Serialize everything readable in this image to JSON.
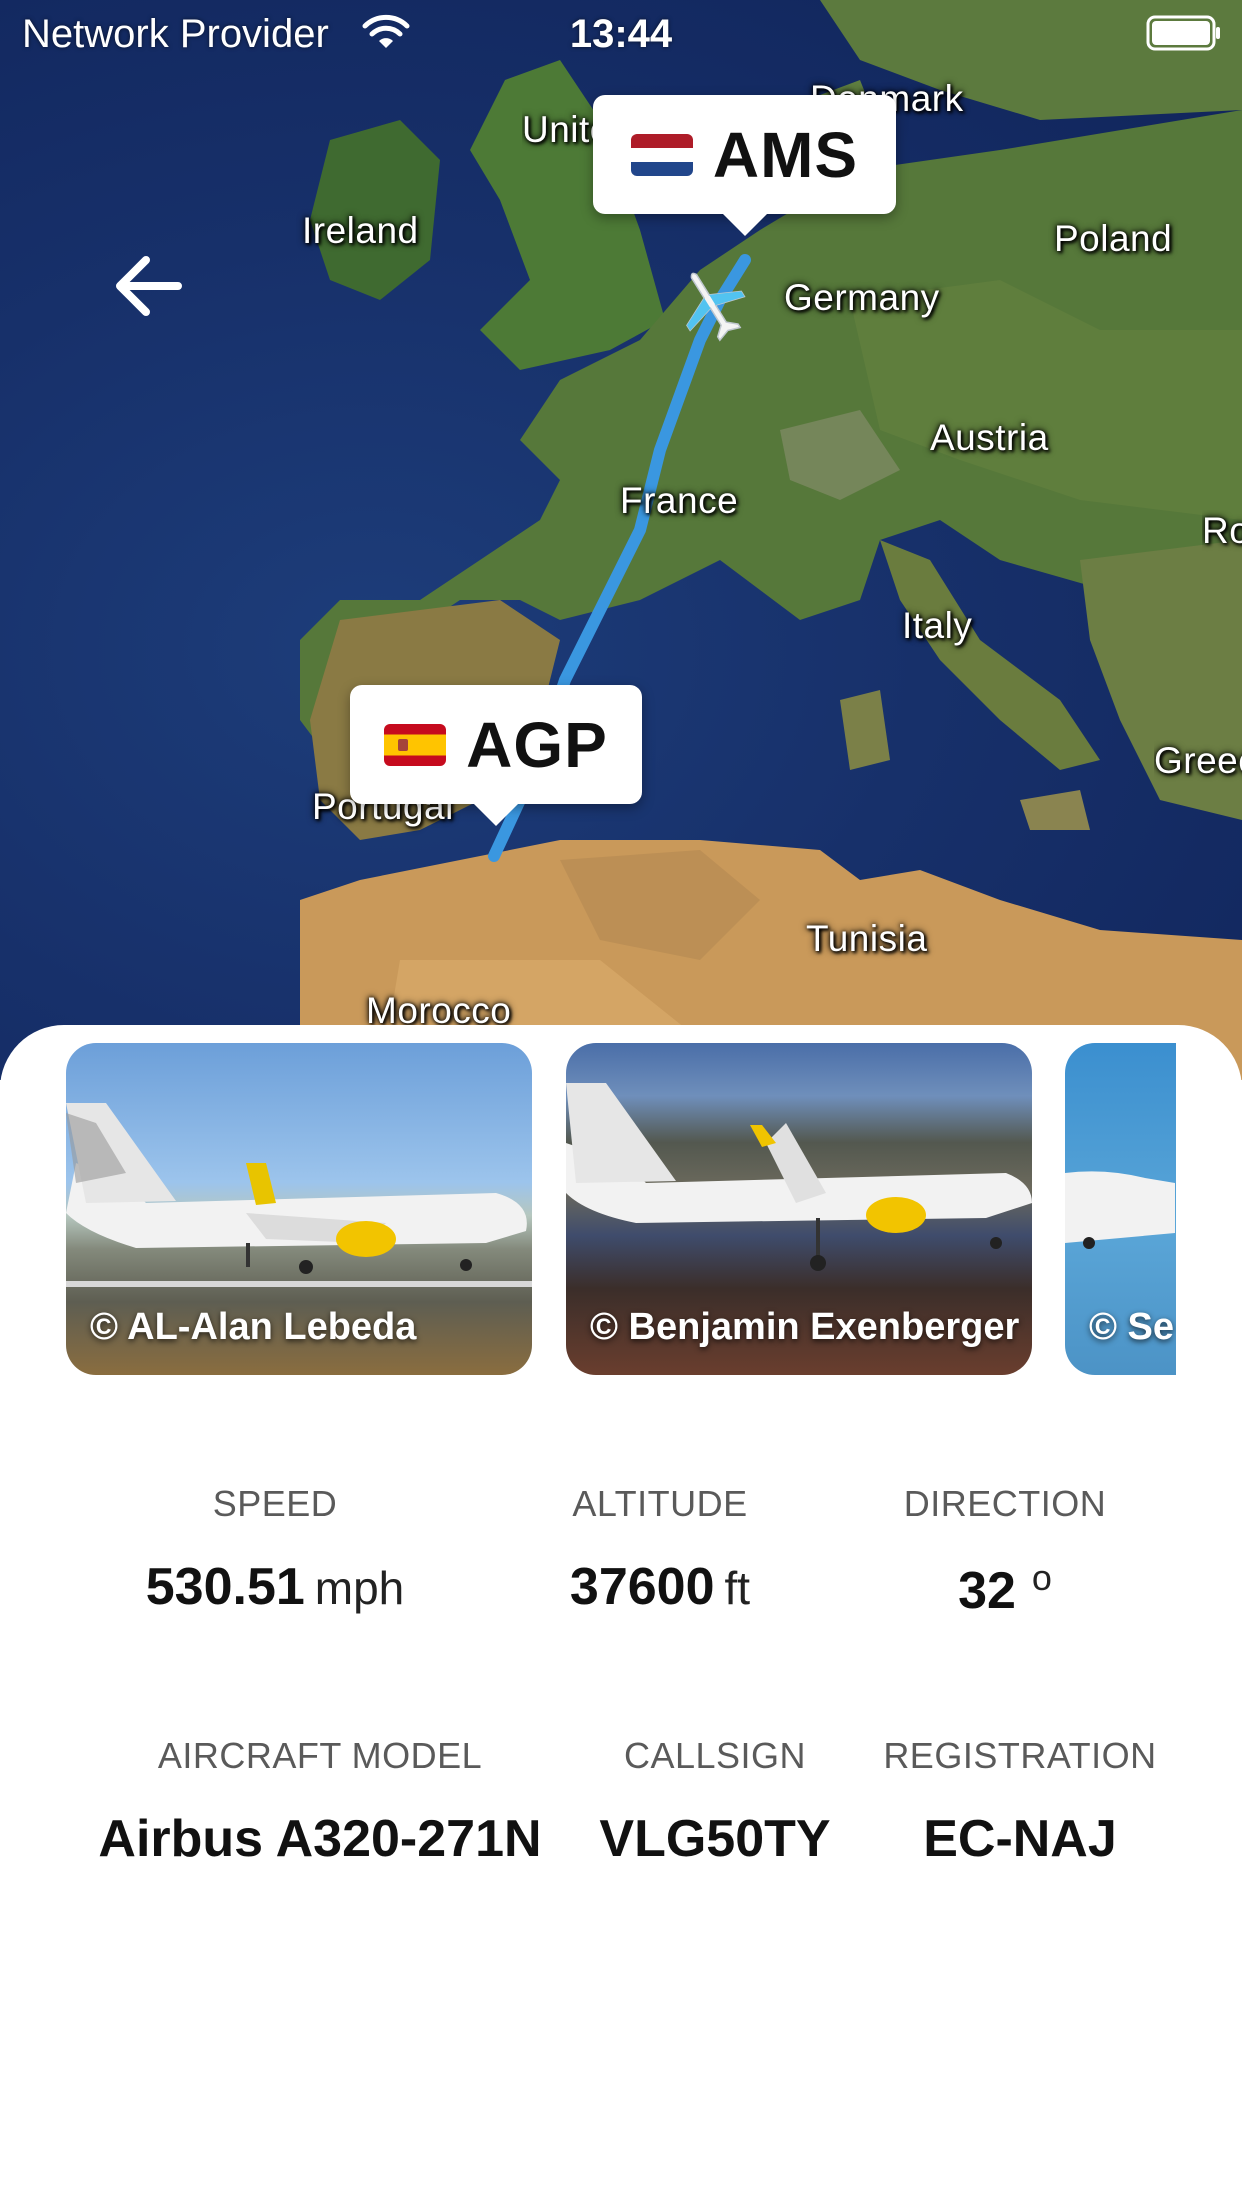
{
  "status_bar": {
    "carrier": "Network Provider",
    "time": "13:44"
  },
  "map": {
    "labels": {
      "ireland": "Ireland",
      "united_kingdom": "United Kingdom",
      "denmark": "Denmark",
      "poland": "Poland",
      "germany": "Germany",
      "austria": "Austria",
      "france": "France",
      "italy": "Italy",
      "romania": "Romania",
      "greece": "Greece",
      "portugal": "Portugal",
      "tunisia": "Tunisia",
      "morocco": "Morocco"
    },
    "route_color": "#3a97e0",
    "destination": {
      "code": "AMS",
      "flag": "netherlands-flag"
    },
    "origin": {
      "code": "AGP",
      "flag": "spain-flag"
    }
  },
  "photos": [
    {
      "credit": "© AL-Alan Lebeda"
    },
    {
      "credit": "© Benjamin Exenberger"
    },
    {
      "credit": "© Se"
    }
  ],
  "stats": {
    "speed": {
      "label": "SPEED",
      "value": "530.51",
      "unit": "mph"
    },
    "altitude": {
      "label": "ALTITUDE",
      "value": "37600",
      "unit": "ft"
    },
    "direction": {
      "label": "DIRECTION",
      "value": "32",
      "unit": "o"
    },
    "aircraft_model": {
      "label": "AIRCRAFT MODEL",
      "value": "Airbus A320-271N"
    },
    "callsign": {
      "label": "CALLSIGN",
      "value": "VLG50TY"
    },
    "registration": {
      "label": "REGISTRATION",
      "value": "EC-NAJ"
    }
  }
}
